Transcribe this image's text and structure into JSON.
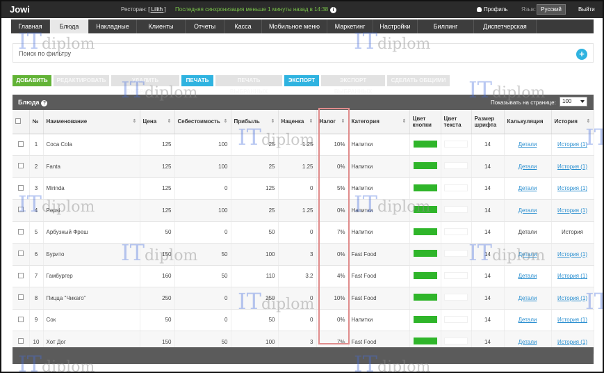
{
  "app": {
    "brand": "Jowi",
    "restaurant_label": "Ресторан:",
    "restaurant_name": "[ Lilith ]",
    "sync_text": "Последняя синхронизация меньше 1 минуты назад в 14:38",
    "profile_label": "Профиль",
    "lang_label": "Язык:",
    "lang_value": "Русский",
    "logout_label": "Выйти"
  },
  "tabs": [
    {
      "label": "Главная",
      "active": false
    },
    {
      "label": "Блюда",
      "active": true
    },
    {
      "label": "Накладные",
      "active": false
    },
    {
      "label": "Клиенты",
      "active": false
    },
    {
      "label": "Отчеты",
      "active": false
    },
    {
      "label": "Касса",
      "active": false
    },
    {
      "label": "Мобильное меню",
      "active": false
    },
    {
      "label": "Маркетинг",
      "active": false
    },
    {
      "label": "Настройки",
      "active": false
    },
    {
      "label": "Биллинг",
      "active": false
    },
    {
      "label": "Диспетчерская",
      "active": false
    }
  ],
  "filter": {
    "label": "Поиск по фильтру",
    "add_symbol": "+"
  },
  "actions": [
    {
      "label": "ДОБАВИТЬ",
      "style": "green"
    },
    {
      "label": "РЕДАКТИРОВАТЬ",
      "style": "disabled"
    },
    {
      "label": "УДАЛИТЬ ВЫБРАННЫЕ",
      "style": "disabled"
    },
    {
      "label": "ПЕЧАТЬ",
      "style": "blue"
    },
    {
      "label": "ПЕЧАТЬ ВЫБРАННЫХ",
      "style": "disabled"
    },
    {
      "label": "ЭКСПОРТ",
      "style": "blue"
    },
    {
      "label": "ЭКСПОРТ ВЫБРАННЫХ",
      "style": "disabled"
    },
    {
      "label": "СДЕЛАТЬ ОБЩИМИ",
      "style": "disabled"
    }
  ],
  "panel": {
    "title": "Блюда",
    "help_symbol": "?",
    "perpage_label": "Показывать на странице:",
    "perpage_value": "100"
  },
  "columns": [
    "",
    "№",
    "Наименование",
    "Цена",
    "Себестоимость",
    "Прибыль",
    "Наценка",
    "Налог",
    "Категория",
    "Цвет кнопки",
    "Цвет текста",
    "Размер шрифта",
    "Калькуляция",
    "История"
  ],
  "rows": [
    {
      "n": "1",
      "name": "Coca Cola",
      "price": "125",
      "cost": "100",
      "profit": "25",
      "markup": "1.25",
      "tax": "10%",
      "category": "Напитки",
      "font": "14",
      "calc": "Детали",
      "calc_link": true,
      "history": "История (1)",
      "history_link": true
    },
    {
      "n": "2",
      "name": "Fanta",
      "price": "125",
      "cost": "100",
      "profit": "25",
      "markup": "1.25",
      "tax": "0%",
      "category": "Напитки",
      "font": "14",
      "calc": "Детали",
      "calc_link": true,
      "history": "История (1)",
      "history_link": true
    },
    {
      "n": "3",
      "name": "Mirinda",
      "price": "125",
      "cost": "0",
      "profit": "125",
      "markup": "0",
      "tax": "5%",
      "category": "Напитки",
      "font": "14",
      "calc": "Детали",
      "calc_link": true,
      "history": "История (1)",
      "history_link": true
    },
    {
      "n": "4",
      "name": "Pepsi",
      "price": "125",
      "cost": "100",
      "profit": "25",
      "markup": "1.25",
      "tax": "0%",
      "category": "Напитки",
      "font": "14",
      "calc": "Детали",
      "calc_link": true,
      "history": "История (1)",
      "history_link": true
    },
    {
      "n": "5",
      "name": "Арбузный Фреш",
      "price": "50",
      "cost": "0",
      "profit": "50",
      "markup": "0",
      "tax": "7%",
      "category": "Напитки",
      "font": "14",
      "calc": "Детали",
      "calc_link": false,
      "history": "История",
      "history_link": false
    },
    {
      "n": "6",
      "name": "Бурито",
      "price": "150",
      "cost": "50",
      "profit": "100",
      "markup": "3",
      "tax": "0%",
      "category": "Fast Food",
      "font": "14",
      "calc": "Детали",
      "calc_link": true,
      "history": "История (1)",
      "history_link": true
    },
    {
      "n": "7",
      "name": "Гамбургер",
      "price": "160",
      "cost": "50",
      "profit": "110",
      "markup": "3.2",
      "tax": "4%",
      "category": "Fast Food",
      "font": "14",
      "calc": "Детали",
      "calc_link": true,
      "history": "История (1)",
      "history_link": true
    },
    {
      "n": "8",
      "name": "Пицца \"Чикаго\"",
      "price": "250",
      "cost": "0",
      "profit": "250",
      "markup": "0",
      "tax": "10%",
      "category": "Fast Food",
      "font": "14",
      "calc": "Детали",
      "calc_link": true,
      "history": "История (1)",
      "history_link": true
    },
    {
      "n": "9",
      "name": "Сок",
      "price": "50",
      "cost": "0",
      "profit": "50",
      "markup": "0",
      "tax": "0%",
      "category": "Напитки",
      "font": "14",
      "calc": "Детали",
      "calc_link": true,
      "history": "История (1)",
      "history_link": true
    },
    {
      "n": "10",
      "name": "Хот Дог",
      "price": "150",
      "cost": "50",
      "profit": "100",
      "markup": "3",
      "tax": "7%",
      "category": "Fast Food",
      "font": "14",
      "calc": "Детали",
      "calc_link": true,
      "history": "История (1)",
      "history_link": true
    }
  ],
  "watermark": {
    "it": "IT",
    "word": "diplom"
  },
  "colors": {
    "accent_blue": "#2fb3e0",
    "accent_green": "#62b336",
    "button_green_swatch": "#2fb52a",
    "topbar": "#2b2b2b",
    "panel": "#5b5b5b"
  }
}
